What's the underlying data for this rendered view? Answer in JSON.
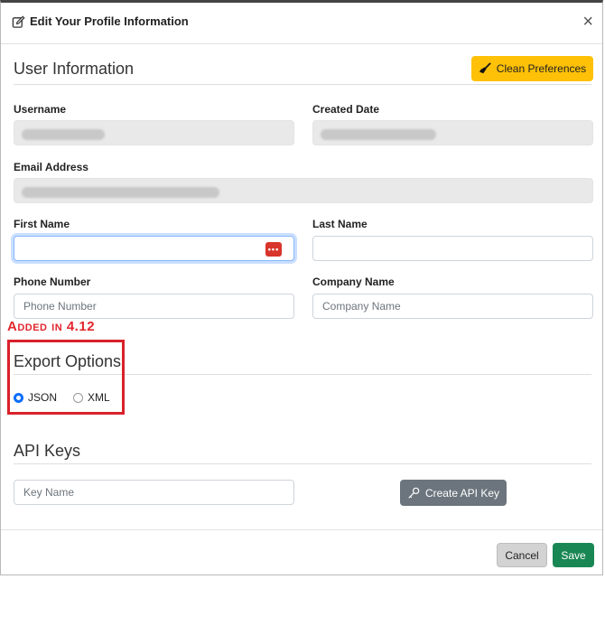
{
  "modal": {
    "title": "Edit Your Profile Information",
    "close_symbol": "×"
  },
  "user_info": {
    "heading": "User Information",
    "clean_button": "Clean Preferences",
    "username_label": "Username",
    "created_label": "Created Date",
    "email_label": "Email Address",
    "first_name_label": "First Name",
    "last_name_label": "Last Name",
    "phone_label": "Phone Number",
    "phone_placeholder": "Phone Number",
    "company_label": "Company Name",
    "company_placeholder": "Company Name"
  },
  "annotation": {
    "text": "Added in 4.12",
    "color": "#e1262d"
  },
  "export": {
    "heading": "Export Options",
    "options": [
      {
        "label": "JSON",
        "checked": true
      },
      {
        "label": "XML",
        "checked": false
      }
    ]
  },
  "api": {
    "heading": "API Keys",
    "key_placeholder": "Key Name",
    "create_button": "Create API Key"
  },
  "footer": {
    "cancel": "Cancel",
    "save": "Save"
  },
  "colors": {
    "accent": "#0d6efd",
    "warning": "#ffc107",
    "success": "#198754"
  }
}
